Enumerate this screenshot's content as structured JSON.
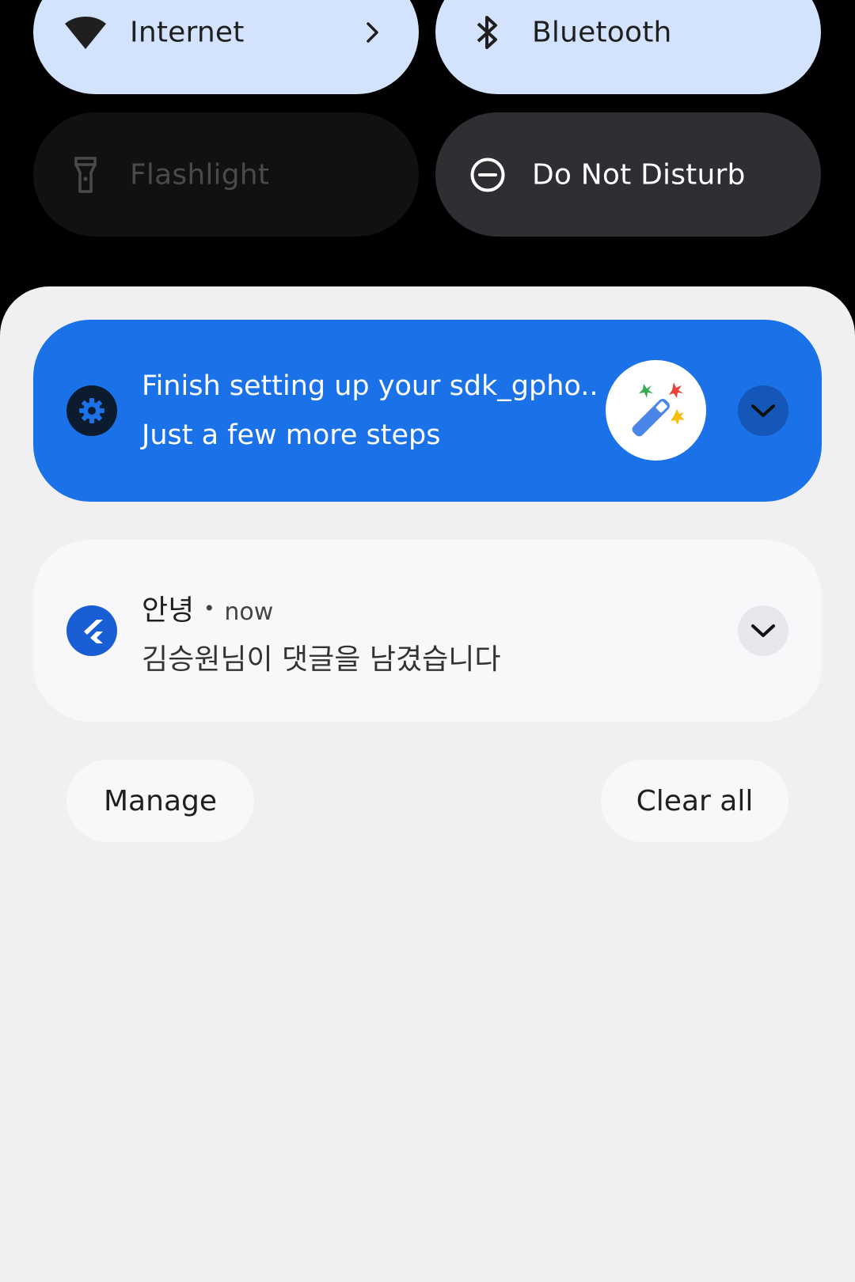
{
  "quick_settings": {
    "tiles": [
      {
        "label": "Internet",
        "icon": "wifi-icon",
        "state": "on",
        "has_chevron": true
      },
      {
        "label": "Bluetooth",
        "icon": "bluetooth-icon",
        "state": "on"
      },
      {
        "label": "Flashlight",
        "icon": "flashlight-icon",
        "state": "unavailable"
      },
      {
        "label": "Do Not Disturb",
        "icon": "do-not-disturb-icon",
        "state": "off"
      }
    ]
  },
  "notifications": [
    {
      "title": "Finish setting up your sdk_gpho..",
      "text": "Just a few more steps",
      "small_icon": "settings-gear-icon",
      "large_icon": "magic-wand-icon",
      "background_color": "#1b72e8"
    },
    {
      "app_name": "안녕",
      "separator": "•",
      "time": "now",
      "text": "김승원님이 댓글을 남겼습니다",
      "small_icon": "flutter-icon",
      "accent_color": "#1a5ed6"
    }
  ],
  "footer": {
    "manage_label": "Manage",
    "clear_all_label": "Clear all"
  },
  "colors": {
    "tile_active": "#d3e3fd",
    "tile_inactive": "#2d2f33",
    "shade_background": "#f0f0f3"
  }
}
